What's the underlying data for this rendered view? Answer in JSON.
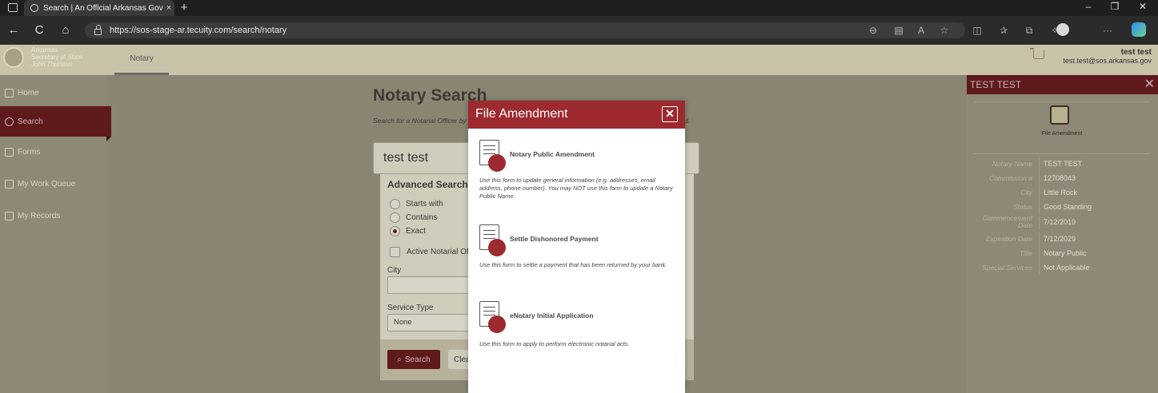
{
  "browser": {
    "tab_title": "Search | An Official Arkansas Gov",
    "tab_close": "×",
    "new_tab": "+",
    "url": "https://sos-stage-ar.tecuity.com/search/notary",
    "nav_back": "←",
    "nav_refresh": "C",
    "nav_home": "⌂",
    "toolbar_icons": [
      "zoom-icon",
      "reader-icon",
      "read-aloud-icon",
      "favorite-icon",
      "split-screen-icon",
      "favorites-icon",
      "collections-icon",
      "extensions-icon",
      "profile-icon",
      "more-icon",
      "copilot-icon"
    ],
    "more_label": "···",
    "window_controls": {
      "minimize": "–",
      "restore": "❐",
      "close": "✕"
    }
  },
  "header": {
    "brand_line1": "Arkansas",
    "brand_line2": "Secretary of State",
    "brand_line3": "John Thurston",
    "nav_tab": "Notary",
    "user_name": "test test",
    "user_email": "test.test@sos.arkansas.gov"
  },
  "sidebar": {
    "items": [
      {
        "label": "Home",
        "icon": "home-icon"
      },
      {
        "label": "Search",
        "icon": "search-icon",
        "active": true
      },
      {
        "label": "Forms",
        "icon": "forms-icon"
      },
      {
        "label": "My Work Queue",
        "icon": "work-queue-icon"
      },
      {
        "label": "My Records",
        "icon": "records-icon"
      }
    ]
  },
  "main": {
    "title": "Notary Search",
    "description": "Search for a Notarial Officer by name, commission number, city, or service type. Special Services offered.",
    "search_value": "test test",
    "advanced": {
      "title": "Advanced Search",
      "match_options": [
        "Starts with",
        "Contains",
        "Exact"
      ],
      "selected_option": "Exact",
      "active_checkbox_label": "Active Notarial Officers Only",
      "city_label": "City",
      "city_value": "",
      "service_type_label": "Service Type",
      "service_type_value": "None",
      "search_button": "Search",
      "clear_button": "Clear"
    }
  },
  "right_panel": {
    "title": "TEST TEST",
    "close": "✕",
    "action_label": "File Amendment",
    "details": [
      {
        "key": "Notary Name",
        "value": "TEST TEST"
      },
      {
        "key": "Commission #",
        "value": "12708043"
      },
      {
        "key": "City",
        "value": "Little Rock"
      },
      {
        "key": "Status",
        "value": "Good Standing"
      },
      {
        "key": "Commencement Date",
        "value": "7/12/2019"
      },
      {
        "key": "Expiration Date",
        "value": "7/12/2029"
      },
      {
        "key": "Title",
        "value": "Notary Public"
      },
      {
        "key": "Special Services",
        "value": "Not Applicable"
      }
    ]
  },
  "modal": {
    "title": "File Amendment",
    "close": "✕",
    "forms": [
      {
        "name": "Notary Public Amendment",
        "description": "Use this form to update general information (e.g. addresses, email address, phone number). You may NOT use this form to update a Notary Public Name."
      },
      {
        "name": "Settle Dishonored Payment",
        "description": "Use this form to settle a payment that has been returned by your bank."
      },
      {
        "name": "eNotary Initial Application",
        "description": "Use this form to apply to perform electronic notarial acts."
      }
    ]
  },
  "colors": {
    "accent": "#9d2a2f",
    "accent_dark": "#5e1a1d",
    "overlay": "#8a8573"
  }
}
